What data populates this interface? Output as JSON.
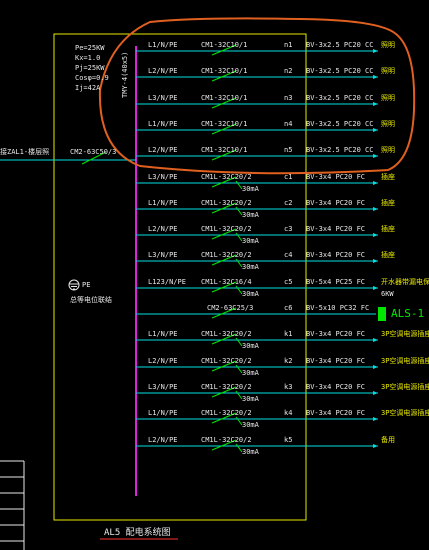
{
  "diagram": {
    "title": "AL5 配电系统图",
    "params": [
      "Pe=25KW",
      "Kx=1.0",
      "Pj=25KW",
      "Cosφ=0.9",
      "Ij=42A"
    ],
    "busbar_label": "TMY-4(40x5)",
    "incoming_label": "接ZAL1-楼层照",
    "main_breaker": "CM2-63C50/3",
    "pe_label": "PE",
    "pe_sub": "总等电位联结",
    "colors": {
      "border": "#e8e800",
      "circuit_line": "#00e0e0",
      "busbar": "#e020e0",
      "breaker": "#00e800",
      "highlight": "#e06020",
      "text": "#e8e8e8"
    },
    "circuits": [
      {
        "phase": "L1/N/PE",
        "breaker": "CM1-32C10/1",
        "rcd": "",
        "id": "n1",
        "cable": "BV-3x2.5 PC20 CC",
        "load": "照明"
      },
      {
        "phase": "L2/N/PE",
        "breaker": "CM1-32C10/1",
        "rcd": "",
        "id": "n2",
        "cable": "BV-3x2.5 PC20 CC",
        "load": "照明"
      },
      {
        "phase": "L3/N/PE",
        "breaker": "CM1-32C10/1",
        "rcd": "",
        "id": "n3",
        "cable": "BV-3x2.5 PC20 CC",
        "load": "照明"
      },
      {
        "phase": "L1/N/PE",
        "breaker": "CM1-32C10/1",
        "rcd": "",
        "id": "n4",
        "cable": "BV-3x2.5 PC20 CC",
        "load": "照明"
      },
      {
        "phase": "L2/N/PE",
        "breaker": "CM1-32C10/1",
        "rcd": "",
        "id": "n5",
        "cable": "BV-3x2.5 PC20 CC",
        "load": "照明"
      },
      {
        "phase": "L3/N/PE",
        "breaker": "CM1L-32C20/2",
        "rcd": "30mA",
        "id": "c1",
        "cable": "BV-3x4 PC20 FC",
        "load": "插座"
      },
      {
        "phase": "L1/N/PE",
        "breaker": "CM1L-32C20/2",
        "rcd": "30mA",
        "id": "c2",
        "cable": "BV-3x4 PC20 FC",
        "load": "插座"
      },
      {
        "phase": "L2/N/PE",
        "breaker": "CM1L-32C20/2",
        "rcd": "30mA",
        "id": "c3",
        "cable": "BV-3x4 PC20 FC",
        "load": "插座"
      },
      {
        "phase": "L3/N/PE",
        "breaker": "CM1L-32C20/2",
        "rcd": "30mA",
        "id": "c4",
        "cable": "BV-3x4 PC20 FC",
        "load": "插座"
      },
      {
        "phase": "L123/N/PE",
        "breaker": "CM1L-32C16/4",
        "rcd": "30mA",
        "id": "c5",
        "cable": "BV-5x4 PC25 FC",
        "load": "开水器带漏电保护",
        "load2": "6KW"
      },
      {
        "phase": "",
        "breaker": "CM2-63C25/3",
        "rcd": "",
        "id": "c6",
        "cable": "BV-5x10 PC32 FC",
        "load": "",
        "box": "ALS-1"
      },
      {
        "phase": "L1/N/PE",
        "breaker": "CM1L-32C20/2",
        "rcd": "30mA",
        "id": "k1",
        "cable": "BV-3x4 PC20 FC",
        "load": "3P空调电源插座"
      },
      {
        "phase": "L2/N/PE",
        "breaker": "CM1L-32C20/2",
        "rcd": "30mA",
        "id": "k2",
        "cable": "BV-3x4 PC20 FC",
        "load": "3P空调电源插座"
      },
      {
        "phase": "L3/N/PE",
        "breaker": "CM1L-32C20/2",
        "rcd": "30mA",
        "id": "k3",
        "cable": "BV-3x4 PC20 FC",
        "load": "3P空调电源插座"
      },
      {
        "phase": "L1/N/PE",
        "breaker": "CM1L-32C20/2",
        "rcd": "30mA",
        "id": "k4",
        "cable": "BV-3x4 PC20 FC",
        "load": "3P空调电源插座"
      },
      {
        "phase": "L2/N/PE",
        "breaker": "CM1L-32C20/2",
        "rcd": "30mA",
        "id": "k5",
        "cable": "",
        "load": "备用"
      }
    ]
  }
}
